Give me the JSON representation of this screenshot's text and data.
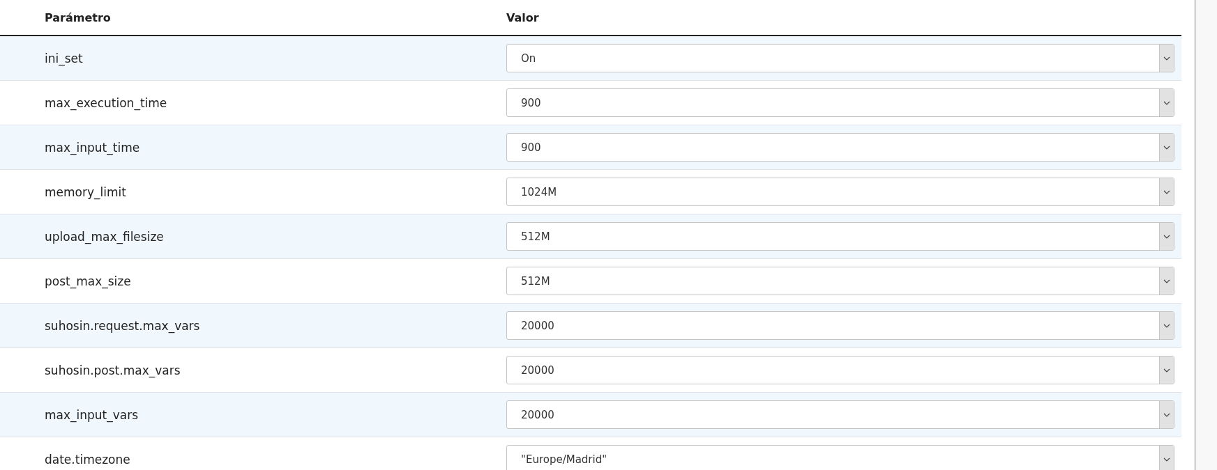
{
  "table": {
    "columns": [
      "Parámetro",
      "Valor"
    ],
    "rows": [
      {
        "parameter": "ini_set",
        "value": "On"
      },
      {
        "parameter": "max_execution_time",
        "value": "900"
      },
      {
        "parameter": "max_input_time",
        "value": "900"
      },
      {
        "parameter": "memory_limit",
        "value": "1024M"
      },
      {
        "parameter": "upload_max_filesize",
        "value": "512M"
      },
      {
        "parameter": "post_max_size",
        "value": "512M"
      },
      {
        "parameter": "suhosin.request.max_vars",
        "value": "20000"
      },
      {
        "parameter": "suhosin.post.max_vars",
        "value": "20000"
      },
      {
        "parameter": "max_input_vars",
        "value": "20000"
      },
      {
        "parameter": "date.timezone",
        "value": "\"Europe/Madrid\""
      }
    ]
  }
}
